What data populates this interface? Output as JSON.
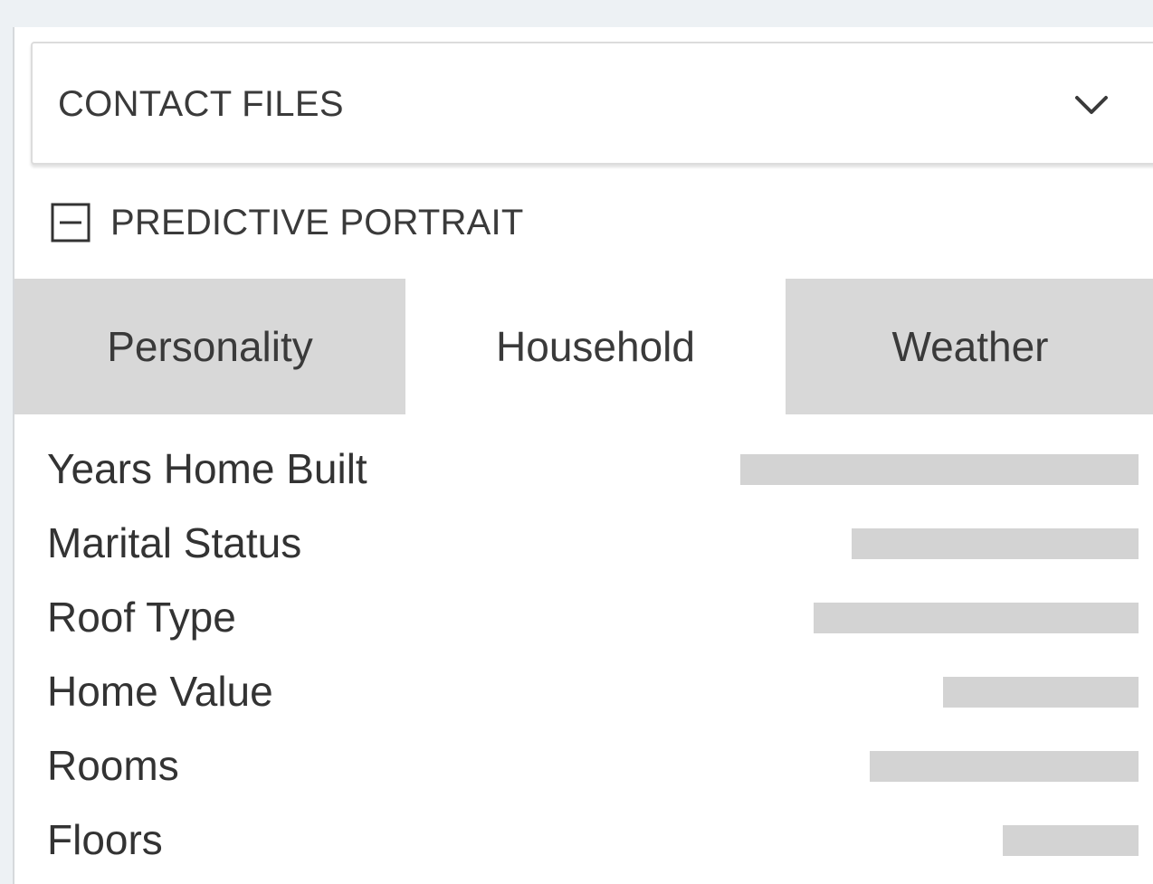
{
  "contact_files": {
    "label": "CONTACT FILES",
    "icon": "chevron-down-icon"
  },
  "predictive_portrait": {
    "title": "PREDICTIVE PORTRAIT",
    "toggle_icon": "collapse-minus-icon",
    "expanded": true
  },
  "tabs": [
    {
      "label": "Personality",
      "active": false
    },
    {
      "label": "Household",
      "active": true
    },
    {
      "label": "Weather",
      "active": false
    }
  ],
  "household_rows": [
    {
      "label": "Years Home Built",
      "value": 1.0
    },
    {
      "label": "Marital Status",
      "value": 0.72
    },
    {
      "label": "Roof Type",
      "value": 0.815
    },
    {
      "label": "Home Value",
      "value": 0.49
    },
    {
      "label": "Rooms",
      "value": 0.675
    },
    {
      "label": "Floors",
      "value": 0.34
    }
  ],
  "colors": {
    "background": "#edf1f4",
    "inactive_tab": "#d8d8d8",
    "bar": "#d3d3d3",
    "text": "#333333"
  }
}
